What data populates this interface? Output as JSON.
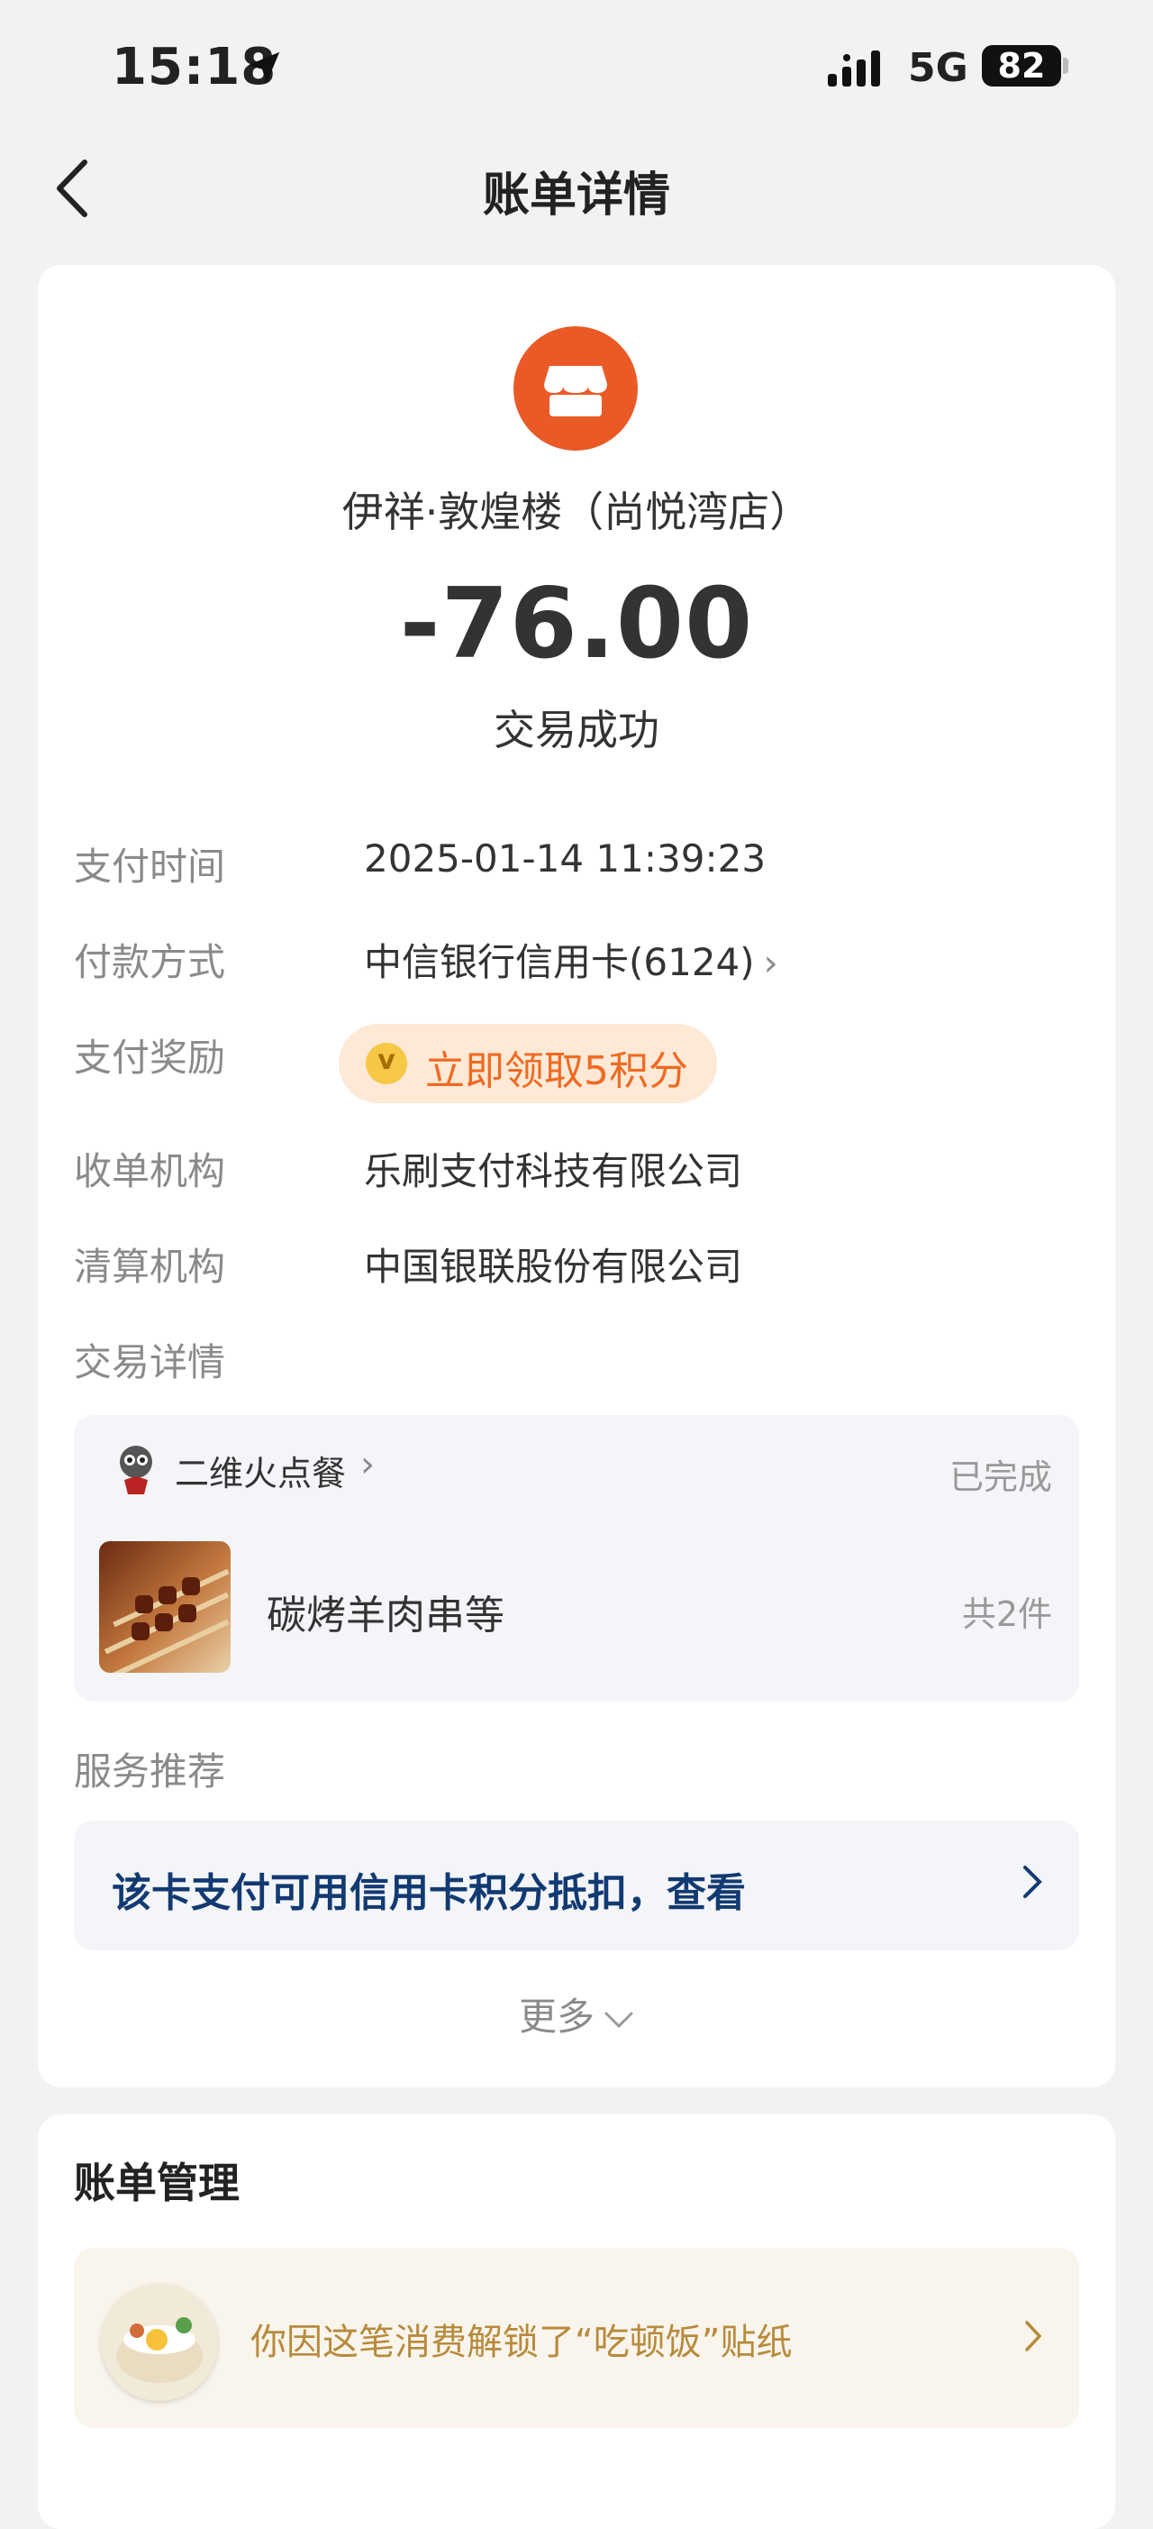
{
  "status_bar": {
    "time": "15:18",
    "network": "5G",
    "battery": "82"
  },
  "header": {
    "title": "账单详情"
  },
  "bill": {
    "merchant": "伊祥·敦煌楼（尚悦湾店）",
    "amount": "-76.00",
    "status": "交易成功"
  },
  "details": {
    "pay_time_label": "支付时间",
    "pay_time_value": "2025-01-14 11:39:23",
    "pay_method_label": "付款方式",
    "pay_method_value": "中信银行信用卡(6124)",
    "reward_label": "支付奖励",
    "reward_text": "立即领取5积分",
    "acquirer_label": "收单机构",
    "acquirer_value": "乐刷支付科技有限公司",
    "clearing_label": "清算机构",
    "clearing_value": "中国银联股份有限公司",
    "trade_detail_label": "交易详情"
  },
  "order": {
    "shop_name": "二维火点餐",
    "status": "已完成",
    "item_name": "碳烤羊肉串等",
    "item_count": "共2件"
  },
  "service": {
    "label": "服务推荐",
    "recommend_text": "该卡支付可用信用卡积分抵扣，查看",
    "more": "更多"
  },
  "manage": {
    "title": "账单管理",
    "sticker_text": "你因这笔消费解锁了“吃顿饭”贴纸"
  },
  "colors": {
    "merchant_icon": "#ea5a26",
    "reward_text": "#ef6a22",
    "recommend_text": "#123a72",
    "sticker_text": "#b88a3c"
  }
}
